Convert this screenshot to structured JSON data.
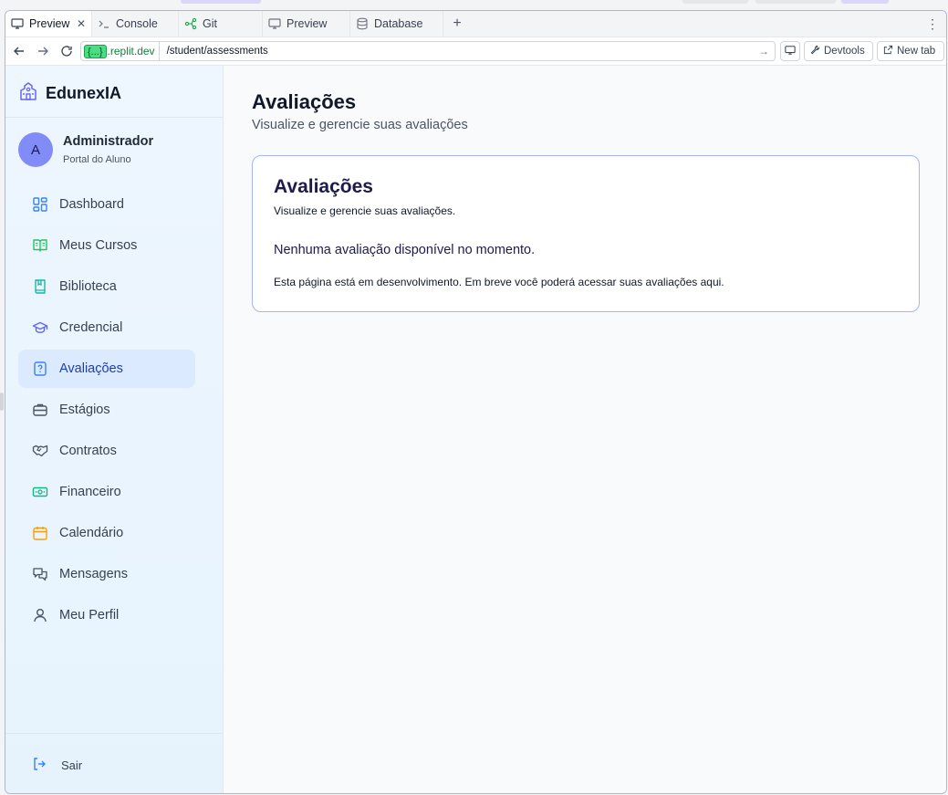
{
  "browser": {
    "tabs": [
      {
        "label": "Preview",
        "icon": "monitor-icon",
        "active": true
      },
      {
        "label": "Console",
        "icon": "terminal-icon",
        "active": false
      },
      {
        "label": "Git",
        "icon": "git-icon",
        "active": false
      },
      {
        "label": "Preview",
        "icon": "monitor-icon",
        "active": false
      },
      {
        "label": "Database",
        "icon": "database-icon",
        "active": false
      }
    ],
    "add_tab": "+",
    "menu": "⋮",
    "url_domain_pill": "{...}",
    "url_domain": ".replit.dev",
    "url_path": "/student/assessments",
    "devtools_label": "Devtools",
    "newtab_label": "New tab"
  },
  "sidebar": {
    "brand": "EdunexIA",
    "user": {
      "initial": "A",
      "name": "Administrador",
      "role": "Portal do Aluno"
    },
    "items": [
      {
        "label": "Dashboard",
        "icon": "dashboard-icon",
        "color": "#3b82f6"
      },
      {
        "label": "Meus Cursos",
        "icon": "book-open-icon",
        "color": "#22c55e"
      },
      {
        "label": "Biblioteca",
        "icon": "library-icon",
        "color": "#14b8a6"
      },
      {
        "label": "Credencial",
        "icon": "graduation-cap-icon",
        "color": "#6366f1"
      },
      {
        "label": "Avaliações",
        "icon": "file-question-icon",
        "color": "#3b82f6",
        "active": true
      },
      {
        "label": "Estágios",
        "icon": "briefcase-icon",
        "color": "#4b5563"
      },
      {
        "label": "Contratos",
        "icon": "handshake-icon",
        "color": "#4b5563"
      },
      {
        "label": "Financeiro",
        "icon": "banknote-icon",
        "color": "#10b981"
      },
      {
        "label": "Calendário",
        "icon": "calendar-icon",
        "color": "#f59e0b"
      },
      {
        "label": "Mensagens",
        "icon": "messages-icon",
        "color": "#4b5563"
      },
      {
        "label": "Meu Perfil",
        "icon": "user-icon",
        "color": "#4b5563"
      }
    ],
    "logout_label": "Sair"
  },
  "main": {
    "title": "Avaliações",
    "subtitle": "Visualize e gerencie suas avaliações",
    "card": {
      "title": "Avaliações",
      "subtitle": "Visualize e gerencie suas avaliações.",
      "empty_message": "Nenhuma avaliação disponível no momento.",
      "note": "Esta página está em desenvolvimento. Em breve você poderá acessar suas avaliações aqui."
    }
  },
  "colors": {
    "accent": "#1e40af",
    "active_bg": "#dbeafe",
    "card_border": "#a5b4fc",
    "brand_green": "#4ade80"
  }
}
